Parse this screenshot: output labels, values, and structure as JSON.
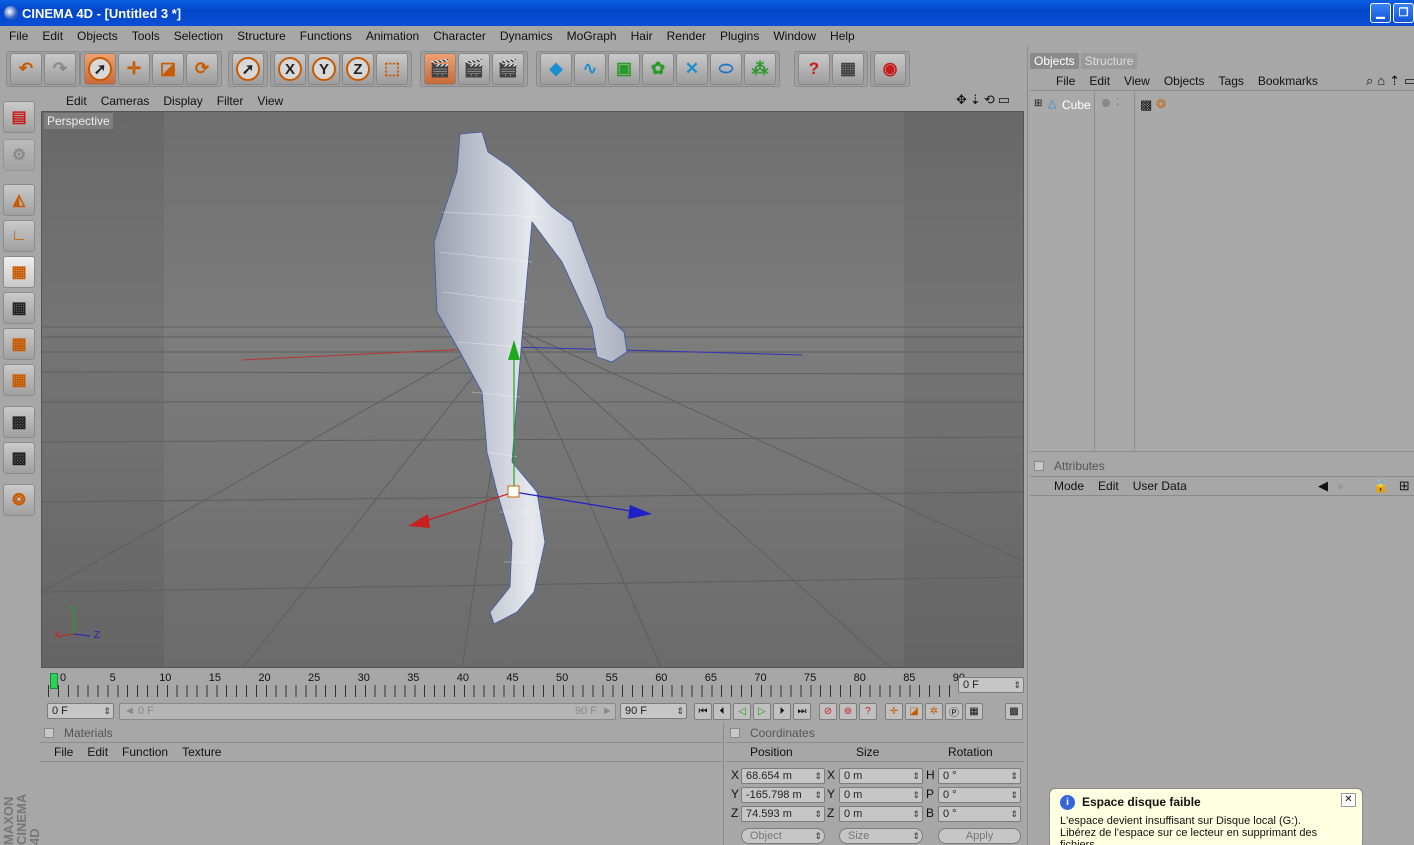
{
  "window": {
    "title": "CINEMA 4D - [Untitled 3 *]"
  },
  "menubar": [
    "File",
    "Edit",
    "Objects",
    "Tools",
    "Selection",
    "Structure",
    "Functions",
    "Animation",
    "Character",
    "Dynamics",
    "MoGraph",
    "Hair",
    "Render",
    "Plugins",
    "Window",
    "Help"
  ],
  "toolbar": {
    "axis_x": "X",
    "axis_y": "Y",
    "axis_z": "Z"
  },
  "viewport": {
    "menu": [
      "Edit",
      "Cameras",
      "Display",
      "Filter",
      "View"
    ],
    "label": "Perspective",
    "axis_y": "Y",
    "axis_x": "X",
    "axis_z": "Z"
  },
  "timeline": {
    "ticks": [
      "0",
      "5",
      "10",
      "15",
      "20",
      "25",
      "30",
      "35",
      "40",
      "45",
      "50",
      "55",
      "60",
      "65",
      "70",
      "75",
      "80",
      "85",
      "90"
    ],
    "current_frame": "0 F",
    "start": "0 F",
    "range_start": "0 F",
    "range_end": "90 F",
    "end": "90 F"
  },
  "objects_panel": {
    "tabs": [
      "Objects",
      "Structure"
    ],
    "menu": [
      "File",
      "Edit",
      "View",
      "Objects",
      "Tags",
      "Bookmarks"
    ],
    "items": [
      {
        "name": "Cube"
      }
    ]
  },
  "attributes_panel": {
    "title": "Attributes",
    "menu": [
      "Mode",
      "Edit",
      "User Data"
    ]
  },
  "materials_panel": {
    "title": "Materials",
    "menu": [
      "File",
      "Edit",
      "Function",
      "Texture"
    ]
  },
  "coordinates_panel": {
    "title": "Coordinates",
    "headers": [
      "Position",
      "Size",
      "Rotation"
    ],
    "rows": [
      {
        "axis": "X",
        "position": "68.654 m",
        "saxis": "X",
        "size": "0 m",
        "raxis": "H",
        "rotation": "0 °"
      },
      {
        "axis": "Y",
        "position": "-165.798 m",
        "saxis": "Y",
        "size": "0 m",
        "raxis": "P",
        "rotation": "0 °"
      },
      {
        "axis": "Z",
        "position": "74.593 m",
        "saxis": "Z",
        "size": "0 m",
        "raxis": "B",
        "rotation": "0 °"
      }
    ],
    "mode": "Object",
    "size_mode": "Size",
    "apply": "Apply"
  },
  "brand": "MAXON CINEMA 4D",
  "notification": {
    "title": "Espace disque faible",
    "line1": "L'espace devient insuffisant sur Disque local (G:).",
    "line2": "Libérez de l'espace sur ce lecteur en supprimant des fichiers"
  },
  "colors": {
    "accent": "#c85a00",
    "viewport": "#6d6d6d",
    "titlebar": "#0246c8"
  }
}
